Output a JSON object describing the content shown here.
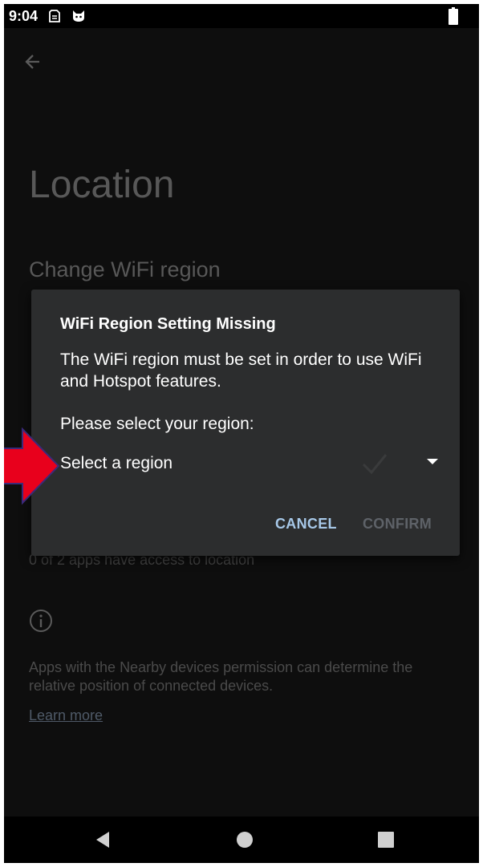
{
  "status_bar": {
    "time": "9:04",
    "icons": [
      "sim-card-icon",
      "cat-icon",
      "battery-icon"
    ]
  },
  "page": {
    "title": "Location",
    "section_title": "Change WiFi region",
    "apps_access_text": "0 of 2 apps have access to location",
    "nearby_text": "Apps with the Nearby devices permission can determine the relative position of connected devices.",
    "learn_more": "Learn more"
  },
  "dialog": {
    "title": "WiFi Region Setting Missing",
    "message": "The WiFi region must be set in order to use WiFi and Hotspot features.",
    "prompt": "Please select your region:",
    "select_value": "Select a region",
    "cancel_label": "CANCEL",
    "confirm_label": "CONFIRM"
  },
  "colors": {
    "dialog_bg": "#2c2d2e",
    "accent": "#a7c8e8",
    "disabled": "#5e6268",
    "annotation_arrow": "#e8001c"
  }
}
